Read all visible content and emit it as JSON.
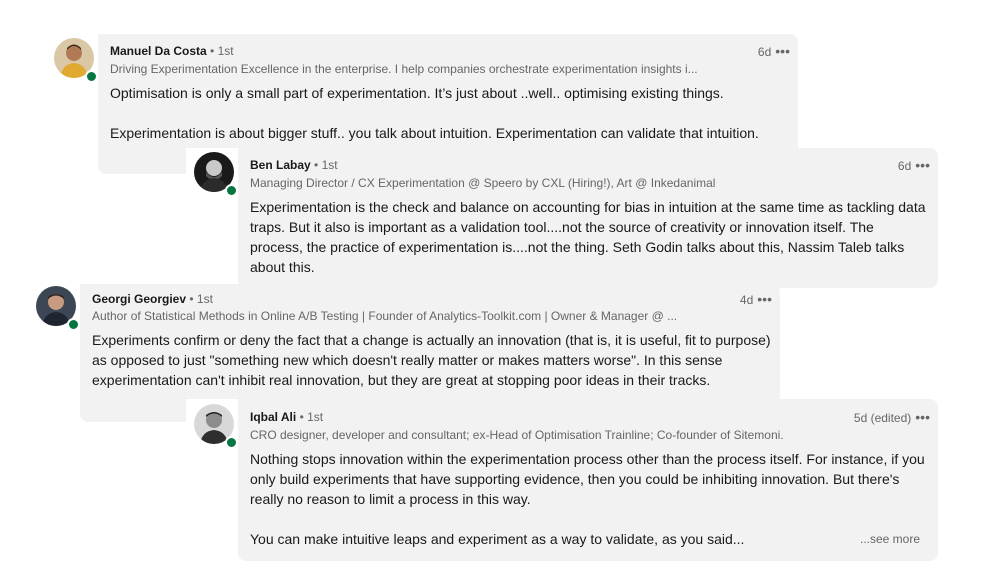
{
  "comments": [
    {
      "name": "Manuel Da Costa",
      "degree": "• 1st",
      "headline": "Driving Experimentation Excellence in the enterprise. I help companies orchestrate experimentation insights i...",
      "time": "6d",
      "more_icon": "•••",
      "avatar_icon": "person-avatar-icon",
      "paragraphs": [
        "Optimisation is only a small part of experimentation. It’s just about ..well.. optimising existing things.",
        "Experimentation is about bigger stuff.. you talk about intuition. Experimentation can validate that intuition."
      ]
    },
    {
      "name": "Ben Labay",
      "degree": "• 1st",
      "headline": "Managing Director / CX Experimentation @ Speero by CXL (Hiring!), Art @ Inkedanimal",
      "time": "6d",
      "more_icon": "•••",
      "avatar_icon": "person-avatar-icon",
      "paragraphs": [
        "Experimentation is the check and balance on accounting for bias in intuition at the same time as tackling data traps. But it also is important as a validation tool....not the source of creativity or innovation itself. The process, the practice of experimentation is....not the thing. Seth Godin talks about this, Nassim Taleb talks about this."
      ]
    },
    {
      "name": "Georgi Georgiev",
      "degree": "• 1st",
      "headline": "Author of Statistical Methods in Online A/B Testing | Founder of Analytics-Toolkit.com | Owner & Manager @ ...",
      "time": "4d",
      "more_icon": "•••",
      "avatar_icon": "person-avatar-icon",
      "paragraphs": [
        "Experiments confirm or deny the fact that a change is actually an innovation (that is, it is useful, fit to purpose) as opposed to just \"something new which doesn't really matter or makes matters worse\". In this sense experimentation can't inhibit real innovation, but they are great at stopping poor ideas in their tracks."
      ]
    },
    {
      "name": "Iqbal Ali",
      "degree": "• 1st",
      "headline": "CRO designer, developer and consultant; ex-Head of Optimisation Trainline; Co-founder of Sitemoni.",
      "time": "5d (edited)",
      "more_icon": "•••",
      "avatar_icon": "person-avatar-icon",
      "paragraphs": [
        "Nothing stops innovation within the experimentation process other than the process itself. For instance, if you only build experiments that have supporting evidence, then you could be inhibiting innovation. But there's really no reason to limit a process in this way.",
        "You can make intuitive leaps and experiment as a way to validate, as you said..."
      ],
      "see_more": "...see more"
    }
  ],
  "colors": {
    "bubble": "#f2f2f2",
    "online": "#057642",
    "secondary_text": "#666666",
    "primary_text": "#191919"
  }
}
